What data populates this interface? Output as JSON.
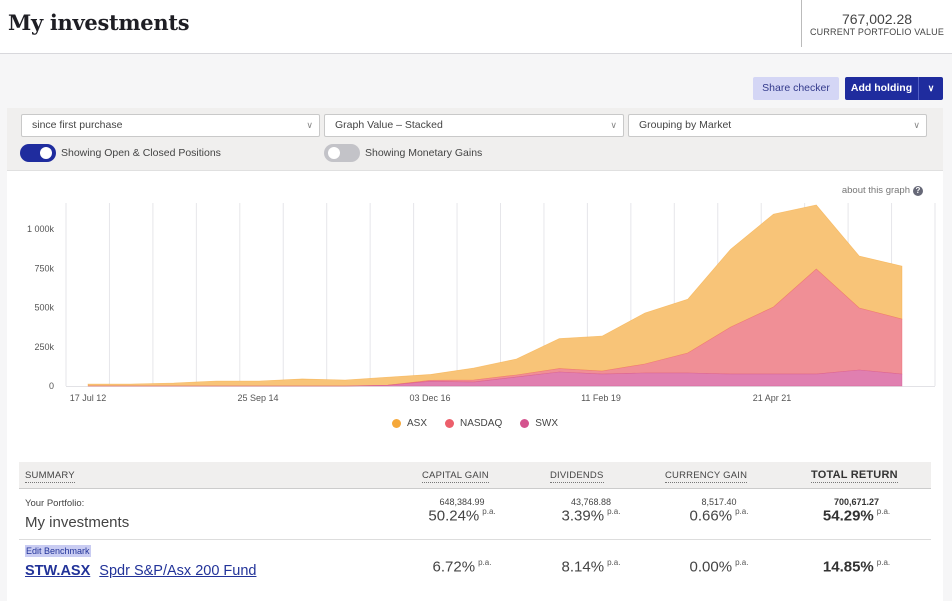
{
  "header": {
    "title": "My investments",
    "portfolio_value": "767,002.28",
    "portfolio_value_label": "CURRENT PORTFOLIO VALUE"
  },
  "actions": {
    "share_checker": "Share checker",
    "add_holding": "Add holding",
    "add_holding_menu_icon": "chevron-down-icon"
  },
  "controls": {
    "period_select": "since first purchase",
    "graph_select": "Graph Value – Stacked",
    "grouping_select": "Grouping by Market",
    "toggle_positions": {
      "label": "Showing Open & Closed Positions",
      "on": true
    },
    "toggle_gains": {
      "label": "Showing Monetary Gains",
      "on": false
    }
  },
  "about_graph": "about this graph",
  "chart_data": {
    "type": "area",
    "stacked": true,
    "title": "",
    "xlabel": "",
    "ylabel": "",
    "ylim": [
      0,
      1100000
    ],
    "yticks": [
      0,
      250000,
      500000,
      750000,
      1000000
    ],
    "ytick_labels": [
      "0",
      "250k",
      "500k",
      "750k",
      "1 000k"
    ],
    "xtick_labels": [
      "17 Jul 12",
      "25 Sep 14",
      "03 Dec 16",
      "11 Feb 19",
      "21 Apr 21"
    ],
    "grid": "vertical",
    "legend_position": "bottom",
    "x_index": [
      0,
      1,
      2,
      3,
      4,
      5,
      6,
      7,
      8,
      9,
      10,
      11,
      12,
      13,
      14,
      15,
      16,
      17,
      18,
      19
    ],
    "xtick_positions": [
      0,
      4,
      8,
      12,
      16
    ],
    "series": [
      {
        "name": "SWX",
        "color": "#d4538e",
        "values": [
          0,
          0,
          0,
          0,
          0,
          0,
          0,
          5000,
          30000,
          25000,
          57000,
          89000,
          76000,
          83000,
          83000,
          76000,
          76000,
          76000,
          102000,
          76000
        ]
      },
      {
        "name": "NASDAQ",
        "color": "#ec5f6b",
        "values": [
          0,
          0,
          0,
          0,
          0,
          0,
          0,
          0,
          6000,
          13000,
          13000,
          22000,
          19000,
          57000,
          127000,
          299000,
          427000,
          669000,
          395000,
          350000
        ]
      },
      {
        "name": "ASX",
        "color": "#f5a83a",
        "values": [
          13000,
          13000,
          19000,
          32000,
          32000,
          45000,
          38000,
          51000,
          38000,
          76000,
          102000,
          191000,
          223000,
          325000,
          343000,
          496000,
          592000,
          408000,
          331000,
          338000
        ]
      }
    ]
  },
  "summary": {
    "headers": {
      "summary": "SUMMARY",
      "capital_gain": "CAPITAL GAIN",
      "dividends": "DIVIDENDS",
      "currency_gain": "CURRENCY GAIN",
      "total_return": "TOTAL RETURN"
    },
    "portfolio": {
      "label": "Your Portfolio:",
      "name": "My investments",
      "capital_gain_amount": "648,384.99",
      "capital_gain_pct": "50.24%",
      "dividends_amount": "43,768.88",
      "dividends_pct": "3.39%",
      "currency_gain_amount": "8,517.40",
      "currency_gain_pct": "0.66%",
      "total_return_amount": "700,671.27",
      "total_return_pct": "54.29%"
    },
    "benchmark": {
      "edit_label": "Edit Benchmark",
      "code": "STW.ASX",
      "name": "Spdr S&P/Asx 200 Fund",
      "capital_gain_pct": "6.72%",
      "dividends_pct": "8.14%",
      "currency_gain_pct": "0.00%",
      "total_return_pct": "14.85%"
    },
    "pa_suffix": "p.a."
  }
}
